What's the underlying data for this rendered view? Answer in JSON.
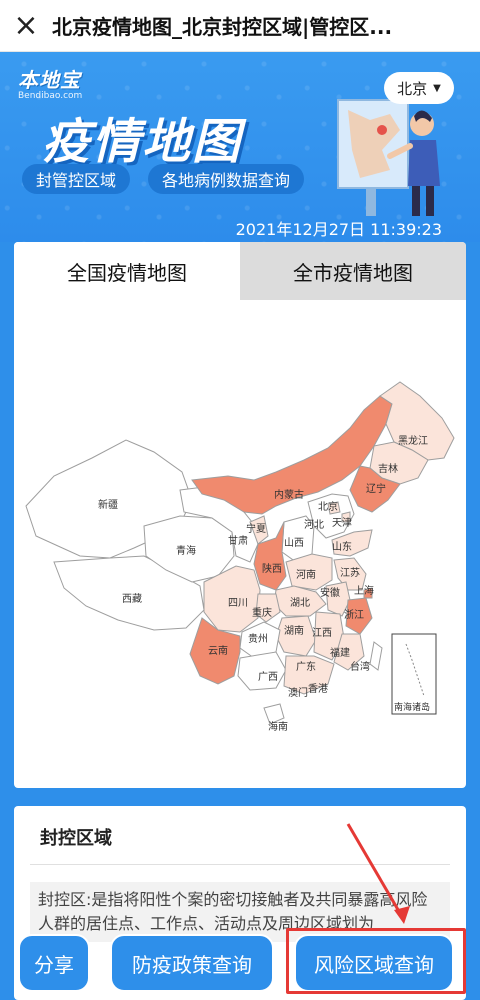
{
  "nav": {
    "title": "北京疫情地图_北京封控区域|管控区...",
    "close_label": "×"
  },
  "banner": {
    "logo": "本地宝",
    "logo_sub": "Bendibao.com",
    "title": "疫情地图",
    "pill_1": "封管控区域",
    "pill_2": "各地病例数据查询",
    "city": "北京",
    "timestamp": "2021年12月27日  11:39:23"
  },
  "tabs": [
    {
      "label": "全国疫情地图",
      "active": true
    },
    {
      "label": "全市疫情地图",
      "active": false
    }
  ],
  "map": {
    "provinces": [
      "新疆",
      "西藏",
      "青海",
      "甘肃",
      "内蒙古",
      "宁夏",
      "陕西",
      "四川",
      "重庆",
      "云南",
      "贵州",
      "广西",
      "海南",
      "湖南",
      "湖北",
      "河南",
      "山西",
      "河北",
      "北京",
      "天津",
      "山东",
      "江苏",
      "安徽",
      "浙江",
      "江西",
      "福建",
      "广东",
      "澳门",
      "香港",
      "台湾",
      "上海",
      "辽宁",
      "吉林",
      "黑龙江"
    ],
    "inset_label": "南海诸岛",
    "colors": {
      "high": "#F08A6E",
      "mid": "#F7C6B5",
      "low": "#FBE4DA",
      "none": "#FFFFFF",
      "border": "#9e9e9e"
    }
  },
  "info": {
    "title": "封控区域",
    "text": "封控区:是指将阳性个案的密切接触者及共同暴露高风险人群的居住点、工作点、活动点及周边区域划为"
  },
  "buttons": {
    "share": "分享",
    "policy": "防疫政策查询",
    "risk": "风险区域查询"
  }
}
